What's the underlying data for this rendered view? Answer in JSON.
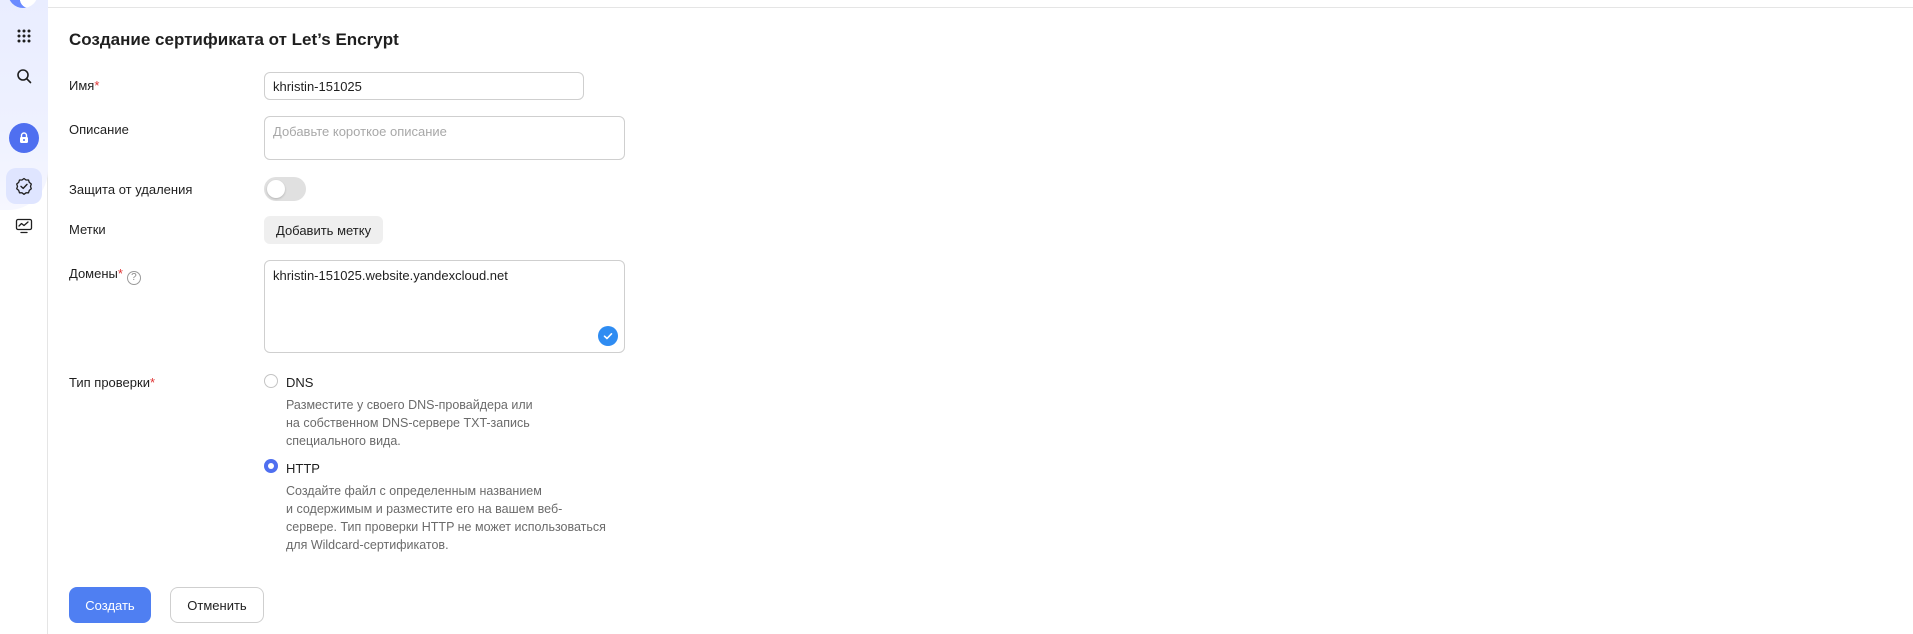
{
  "page": {
    "title": "Создание сертификата от Let’s Encrypt"
  },
  "form": {
    "name": {
      "label": "Имя",
      "required_mark": "*",
      "value": "khristin-151025"
    },
    "description": {
      "label": "Описание",
      "placeholder": "Добавьте короткое описание"
    },
    "deletion_protection": {
      "label": "Защита от удаления",
      "enabled": false
    },
    "labels": {
      "label": "Метки",
      "add_button": "Добавить метку"
    },
    "domains": {
      "label": "Домены",
      "required_mark": "*",
      "help_icon": "?",
      "value": "khristin-151025.website.yandexcloud.net",
      "valid_icon": "check-icon"
    },
    "verification": {
      "label": "Тип проверки",
      "required_mark": "*",
      "options": [
        {
          "label": "DNS",
          "checked": false,
          "description": [
            "Разместите у своего DNS-провайдера или",
            "на собственном DNS-сервере TXT-запись",
            "специального вида."
          ]
        },
        {
          "label": "HTTP",
          "checked": true,
          "description": [
            "Создайте файл с определенным названием",
            "и содержимым и разместите его на вашем веб-",
            "сервере. Тип проверки HTTP не может использоваться",
            "для Wildcard-сертификатов."
          ]
        }
      ]
    }
  },
  "actions": {
    "create": "Создать",
    "cancel": "Отменить"
  },
  "sidebar": {
    "icons": [
      "apps-grid-icon",
      "search-icon",
      "certificate-manager-lock-icon",
      "certificate-icon",
      "monitoring-icon"
    ]
  },
  "colors": {
    "accent": "#4f7ff2",
    "required": "#e03434",
    "valid": "#2f8cf2"
  }
}
